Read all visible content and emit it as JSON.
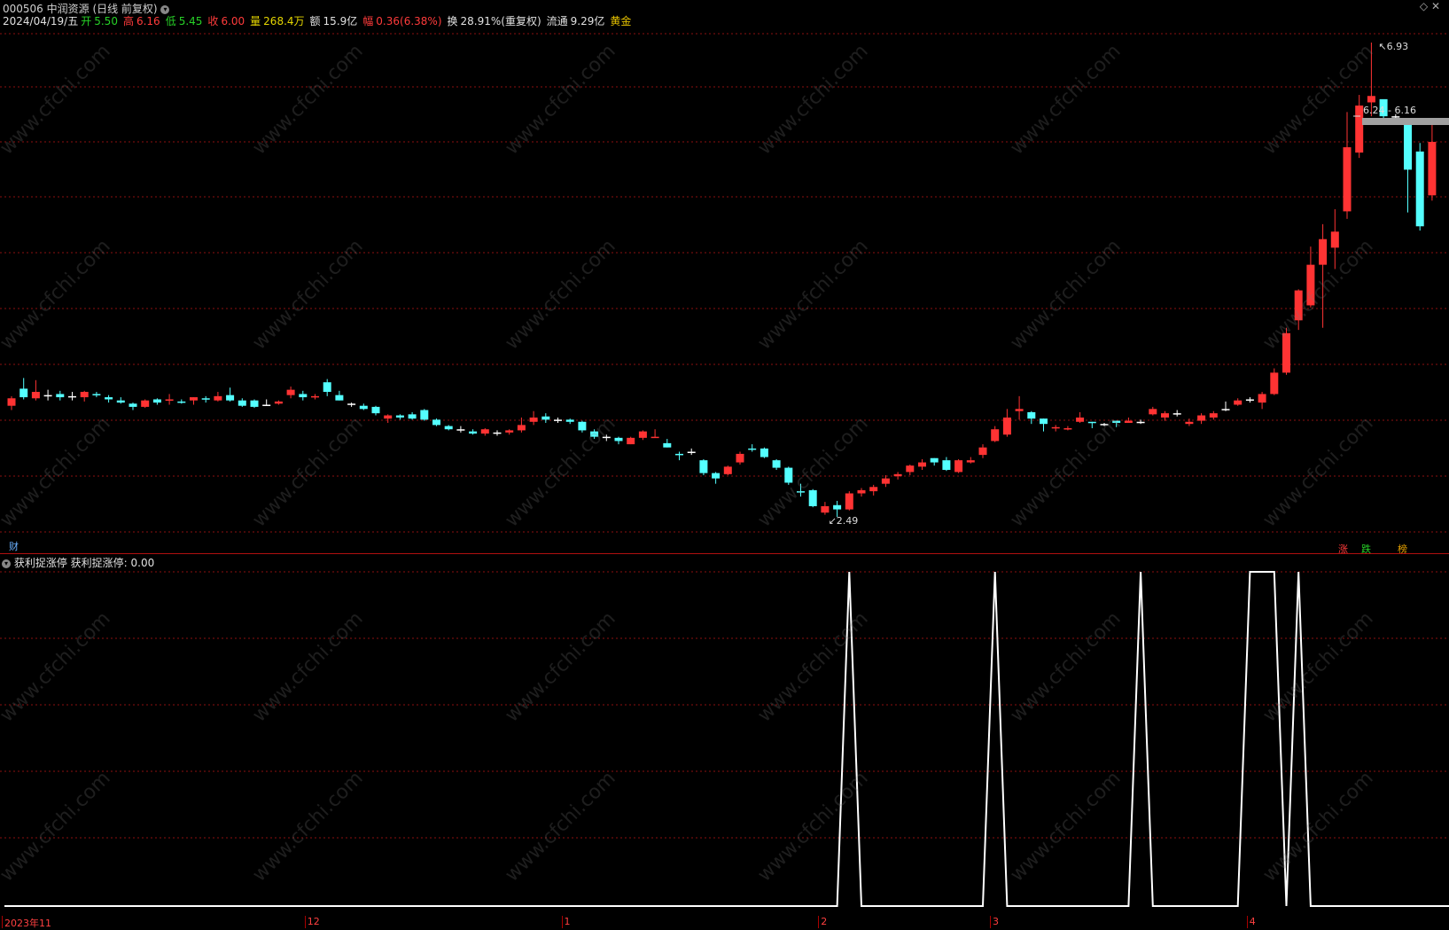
{
  "header": {
    "title": "000506 中润资源 (日线 前复权)",
    "date": "2024/04/19/五",
    "open_label": "开",
    "open": "5.50",
    "high_label": "高",
    "high": "6.16",
    "low_label": "低",
    "low": "5.45",
    "close_label": "收",
    "close": "6.00",
    "vol_label": "量",
    "vol": "268.4万",
    "amt_label": "额",
    "amt": "15.9亿",
    "chg_label": "幅",
    "chg": "0.36(6.38%)",
    "turn_label": "换",
    "turn": "28.91%(重复权)",
    "float_label": "流通",
    "float": "9.29亿",
    "gold": "黄金"
  },
  "main": {
    "high_marker": "6.93",
    "low_marker": "2.49",
    "range_label": "6.24 - 6.16",
    "fin_badge": "财",
    "badges": [
      "涨",
      "跌",
      "榜"
    ]
  },
  "indicator": {
    "name": "获利捉涨停",
    "value_label": "获利捉涨停: 0.00"
  },
  "xaxis": {
    "labels": [
      "2023年11",
      "12",
      "1",
      "2",
      "3",
      "4"
    ]
  },
  "watermark": "www.cfchi.com",
  "colors": {
    "up": "#ff3333",
    "down": "#54ffff",
    "flat": "#ffffff",
    "grid": "#8b1010"
  },
  "chart_data": {
    "type": "candlestick",
    "candles": [
      [
        3.53,
        3.6,
        3.62,
        3.49
      ],
      [
        3.69,
        3.61,
        3.79,
        3.59
      ],
      [
        3.6,
        3.66,
        3.77,
        3.58
      ],
      [
        3.63,
        3.63,
        3.68,
        3.58
      ],
      [
        3.64,
        3.61,
        3.67,
        3.58
      ],
      [
        3.62,
        3.62,
        3.66,
        3.58
      ],
      [
        3.61,
        3.66,
        3.67,
        3.57
      ],
      [
        3.64,
        3.63,
        3.66,
        3.61
      ],
      [
        3.61,
        3.59,
        3.63,
        3.56
      ],
      [
        3.58,
        3.56,
        3.61,
        3.55
      ],
      [
        3.55,
        3.52,
        3.56,
        3.49
      ],
      [
        3.52,
        3.58,
        3.59,
        3.51
      ],
      [
        3.59,
        3.56,
        3.6,
        3.54
      ],
      [
        3.58,
        3.59,
        3.64,
        3.54
      ],
      [
        3.57,
        3.56,
        3.59,
        3.55
      ],
      [
        3.58,
        3.61,
        3.61,
        3.54
      ],
      [
        3.6,
        3.59,
        3.62,
        3.56
      ],
      [
        3.58,
        3.62,
        3.66,
        3.57
      ],
      [
        3.63,
        3.58,
        3.7,
        3.57
      ],
      [
        3.58,
        3.53,
        3.6,
        3.52
      ],
      [
        3.58,
        3.52,
        3.59,
        3.51
      ],
      [
        3.54,
        3.54,
        3.59,
        3.53
      ],
      [
        3.55,
        3.57,
        3.58,
        3.54
      ],
      [
        3.63,
        3.68,
        3.71,
        3.6
      ],
      [
        3.64,
        3.61,
        3.67,
        3.58
      ],
      [
        3.61,
        3.62,
        3.64,
        3.59
      ],
      [
        3.75,
        3.66,
        3.78,
        3.62
      ],
      [
        3.63,
        3.58,
        3.67,
        3.58
      ],
      [
        3.55,
        3.55,
        3.56,
        3.52
      ],
      [
        3.53,
        3.5,
        3.55,
        3.49
      ],
      [
        3.52,
        3.46,
        3.53,
        3.44
      ],
      [
        3.41,
        3.44,
        3.45,
        3.37
      ],
      [
        3.44,
        3.42,
        3.45,
        3.4
      ],
      [
        3.45,
        3.41,
        3.47,
        3.4
      ],
      [
        3.49,
        3.4,
        3.5,
        3.39
      ],
      [
        3.4,
        3.35,
        3.41,
        3.34
      ],
      [
        3.34,
        3.31,
        3.35,
        3.3
      ],
      [
        3.31,
        3.31,
        3.34,
        3.28
      ],
      [
        3.29,
        3.27,
        3.31,
        3.26
      ],
      [
        3.27,
        3.31,
        3.32,
        3.25
      ],
      [
        3.28,
        3.28,
        3.3,
        3.25
      ],
      [
        3.28,
        3.3,
        3.31,
        3.26
      ],
      [
        3.3,
        3.35,
        3.42,
        3.28
      ],
      [
        3.38,
        3.42,
        3.48,
        3.35
      ],
      [
        3.43,
        3.4,
        3.46,
        3.37
      ],
      [
        3.4,
        3.4,
        3.42,
        3.37
      ],
      [
        3.4,
        3.38,
        3.41,
        3.36
      ],
      [
        3.38,
        3.3,
        3.39,
        3.28
      ],
      [
        3.29,
        3.24,
        3.31,
        3.22
      ],
      [
        3.24,
        3.24,
        3.26,
        3.2
      ],
      [
        3.23,
        3.2,
        3.24,
        3.17
      ],
      [
        3.17,
        3.23,
        3.24,
        3.17
      ],
      [
        3.23,
        3.29,
        3.3,
        3.21
      ],
      [
        3.23,
        3.24,
        3.31,
        3.23
      ],
      [
        3.18,
        3.14,
        3.22,
        3.14
      ],
      [
        3.08,
        3.07,
        3.1,
        3.02
      ],
      [
        3.1,
        3.1,
        3.13,
        3.07
      ],
      [
        3.02,
        2.9,
        3.03,
        2.88
      ],
      [
        2.9,
        2.85,
        2.91,
        2.8
      ],
      [
        2.89,
        2.96,
        2.97,
        2.88
      ],
      [
        3.0,
        3.08,
        3.1,
        2.98
      ],
      [
        3.13,
        3.12,
        3.17,
        3.1
      ],
      [
        3.13,
        3.05,
        3.14,
        3.04
      ],
      [
        3.02,
        2.95,
        3.03,
        2.93
      ],
      [
        2.95,
        2.81,
        2.96,
        2.79
      ],
      [
        2.73,
        2.72,
        2.8,
        2.68
      ],
      [
        2.74,
        2.59,
        2.75,
        2.58
      ],
      [
        2.53,
        2.59,
        2.63,
        2.51
      ],
      [
        2.6,
        2.56,
        2.64,
        2.49
      ],
      [
        2.56,
        2.71,
        2.73,
        2.55
      ],
      [
        2.71,
        2.74,
        2.76,
        2.68
      ],
      [
        2.73,
        2.77,
        2.79,
        2.69
      ],
      [
        2.8,
        2.85,
        2.88,
        2.77
      ],
      [
        2.87,
        2.89,
        2.91,
        2.84
      ],
      [
        2.91,
        2.97,
        2.98,
        2.88
      ],
      [
        2.96,
        3.0,
        3.03,
        2.93
      ],
      [
        3.04,
        3.0,
        3.04,
        2.97
      ],
      [
        3.02,
        2.93,
        3.05,
        2.92
      ],
      [
        2.91,
        3.02,
        3.03,
        2.9
      ],
      [
        3.0,
        3.02,
        3.05,
        2.99
      ],
      [
        3.07,
        3.14,
        3.17,
        3.04
      ],
      [
        3.2,
        3.31,
        3.34,
        3.19
      ],
      [
        3.26,
        3.42,
        3.5,
        3.24
      ],
      [
        3.48,
        3.5,
        3.62,
        3.4
      ],
      [
        3.47,
        3.41,
        3.48,
        3.36
      ],
      [
        3.41,
        3.36,
        3.41,
        3.29
      ],
      [
        3.32,
        3.33,
        3.35,
        3.29
      ],
      [
        3.31,
        3.32,
        3.34,
        3.3
      ],
      [
        3.38,
        3.42,
        3.47,
        3.37
      ],
      [
        3.38,
        3.37,
        3.38,
        3.32
      ],
      [
        3.36,
        3.36,
        3.37,
        3.34
      ],
      [
        3.39,
        3.37,
        3.39,
        3.33
      ],
      [
        3.37,
        3.39,
        3.42,
        3.37
      ],
      [
        3.38,
        3.38,
        3.4,
        3.36
      ],
      [
        3.45,
        3.5,
        3.52,
        3.44
      ],
      [
        3.42,
        3.46,
        3.48,
        3.39
      ],
      [
        3.46,
        3.46,
        3.49,
        3.43
      ],
      [
        3.36,
        3.38,
        3.41,
        3.34
      ],
      [
        3.39,
        3.44,
        3.46,
        3.36
      ],
      [
        3.42,
        3.46,
        3.48,
        3.4
      ],
      [
        3.5,
        3.5,
        3.57,
        3.48
      ],
      [
        3.54,
        3.58,
        3.6,
        3.53
      ],
      [
        3.59,
        3.59,
        3.61,
        3.56
      ],
      [
        3.56,
        3.64,
        3.66,
        3.5
      ],
      [
        3.64,
        3.84,
        3.88,
        3.63
      ],
      [
        3.84,
        4.21,
        4.26,
        3.82
      ],
      [
        4.33,
        4.61,
        4.62,
        4.24
      ],
      [
        4.47,
        4.85,
        5.02,
        4.45
      ],
      [
        4.85,
        5.09,
        5.23,
        4.26
      ],
      [
        5.01,
        5.16,
        5.37,
        4.81
      ],
      [
        5.35,
        5.95,
        6.28,
        5.28
      ],
      [
        5.9,
        6.34,
        6.44,
        5.85
      ],
      [
        6.37,
        6.43,
        6.93,
        6.24
      ],
      [
        6.4,
        6.24,
        6.26,
        6.22
      ],
      [
        6.24,
        6.24,
        6.26,
        6.22
      ],
      [
        6.16,
        5.74,
        6.16,
        5.34
      ],
      [
        5.91,
        5.21,
        5.99,
        5.17
      ],
      [
        5.5,
        6.0,
        6.16,
        5.45
      ]
    ],
    "indicator": [
      0,
      0,
      0,
      0,
      0,
      0,
      0,
      0,
      0,
      0,
      0,
      0,
      0,
      0,
      0,
      0,
      0,
      0,
      0,
      0,
      0,
      0,
      0,
      0,
      0,
      0,
      0,
      0,
      0,
      0,
      0,
      0,
      0,
      0,
      0,
      0,
      0,
      0,
      0,
      0,
      0,
      0,
      0,
      0,
      0,
      0,
      0,
      0,
      0,
      0,
      0,
      0,
      0,
      0,
      0,
      0,
      0,
      0,
      0,
      0,
      0,
      0,
      0,
      0,
      0,
      0,
      0,
      0,
      0,
      1,
      0,
      0,
      0,
      0,
      0,
      0,
      0,
      0,
      0,
      0,
      0,
      1,
      0,
      0,
      0,
      0,
      0,
      0,
      0,
      0,
      0,
      0,
      0,
      1,
      0,
      0,
      0,
      0,
      0,
      0,
      0,
      0,
      1,
      1,
      1,
      0,
      1,
      0,
      0,
      0,
      0,
      0,
      0,
      0,
      0,
      0,
      0,
      0,
      0,
      0,
      0,
      0,
      0
    ]
  }
}
